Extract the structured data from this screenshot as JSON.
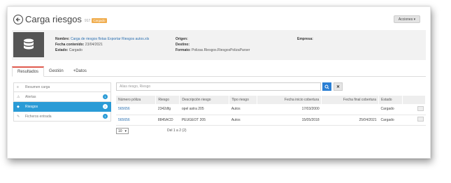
{
  "header": {
    "title": "Carga riesgos",
    "id": "917",
    "badge": "Cargado",
    "actions_label": "Acciones ▾"
  },
  "info": {
    "nombre_label": "Nombre:",
    "nombre_value": "Carga de riesgos flotas Exportar Riesgos autos.xls",
    "fecha_label": "Fecha contenido:",
    "fecha_value": "23/04/2021",
    "estado_label": "Estado:",
    "estado_value": "Cargado",
    "origen_label": "Origen:",
    "destino_label": "Destino:",
    "formato_label": "Formato:",
    "formato_value": "Polizas.Riesgos.RiesgosPolizaParser",
    "empresa_label": "Empresa:"
  },
  "tabs": [
    {
      "label": "Resultados"
    },
    {
      "label": "Gestión"
    },
    {
      "label": "+Datos"
    }
  ],
  "sidebar": {
    "items": [
      {
        "label": "Resumen carga",
        "icon": "≡",
        "count": ""
      },
      {
        "label": "Alertas",
        "icon": "⚠",
        "count": "1"
      },
      {
        "label": "Riesgos",
        "icon": "◆",
        "count": "2"
      },
      {
        "label": "Ficheros entrada",
        "icon": "✎",
        "count": "1"
      }
    ]
  },
  "search": {
    "placeholder": "Alias riesgo, Riesgo"
  },
  "table": {
    "headers": [
      "Número póliza",
      "Riesgo",
      "Descripción riesgo",
      "Tipo riesgo",
      "Fecha inicio cobertura",
      "Fecha final cobertura",
      "Estado",
      ""
    ],
    "rows": [
      [
        "565656",
        "2342dfg",
        "opel astra 205",
        "Autos",
        "17/03/2000",
        "",
        "Cargado"
      ],
      [
        "565656",
        "8845ACD",
        "PEUGEOT 205",
        "Autos",
        "15/05/2018",
        "25/04/2021",
        "Cargado"
      ]
    ]
  },
  "pager": {
    "page_size": "10",
    "info": "Del 1 a 2 (2)"
  },
  "colors": {
    "accent_blue": "#2a9bd6",
    "badge_orange": "#f0ad4e",
    "tab_red": "#e05a4e"
  }
}
